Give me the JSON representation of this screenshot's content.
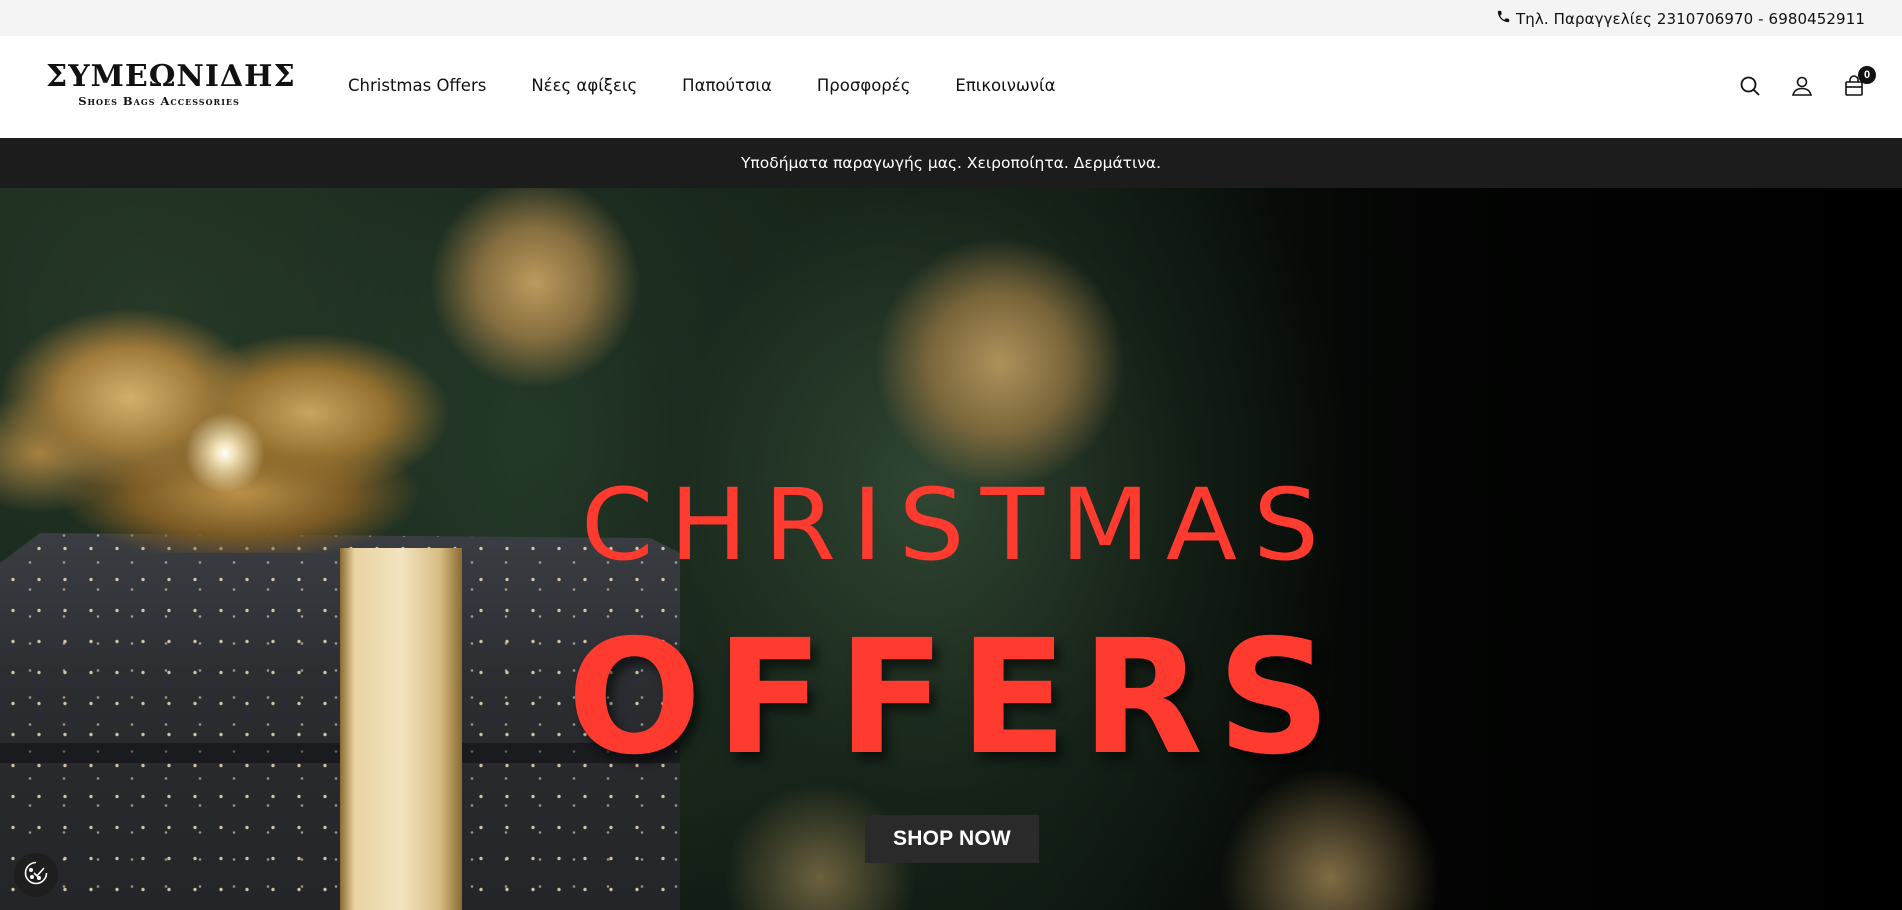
{
  "topbar": {
    "phone_text": "Τηλ. Παραγγελίες 2310706970 - 6980452911",
    "phone_icon": "phone-icon"
  },
  "header": {
    "logo": {
      "brand": "ΣΥΜΕΩΝΙΔΗΣ",
      "tagline": "Shoes Bags Accessories"
    },
    "nav": [
      {
        "label": "Christmas Offers"
      },
      {
        "label": "Νέες αφίξεις"
      },
      {
        "label": "Παπούτσια"
      },
      {
        "label": "Προσφορές"
      },
      {
        "label": "Επικοινωνία"
      }
    ],
    "icons": [
      "search-icon",
      "account-icon",
      "cart-icon"
    ],
    "cart_count": "0"
  },
  "announcement": {
    "text": "Υποδήματα παραγωγής μας. Χειροποίητα. Δερμάτινα."
  },
  "hero": {
    "line1": "CHRISTMAS",
    "line2": "OFFERS",
    "cta": "SHOP NOW",
    "accent_color": "#ff3b30"
  },
  "cookie": {
    "icon": "cookie-settings-icon"
  }
}
